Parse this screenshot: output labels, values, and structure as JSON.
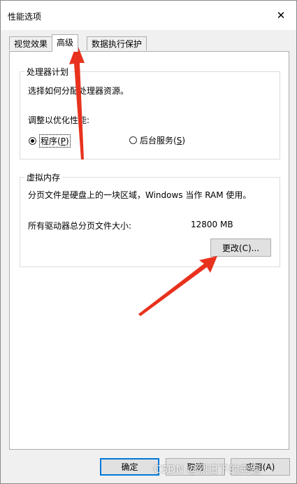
{
  "window": {
    "title": "性能选项",
    "close_glyph": "✕"
  },
  "tabs": [
    {
      "label": "视觉效果",
      "active": false
    },
    {
      "label": "高级",
      "active": true
    },
    {
      "label": "数据执行保护",
      "active": false
    }
  ],
  "processor": {
    "legend": "处理器计划",
    "description": "选择如何分配处理器资源。",
    "adjust_label": "调整以优化性能:",
    "options": [
      {
        "label": "程序(",
        "mnemonic": "P",
        "suffix": ")",
        "checked": true
      },
      {
        "label": "后台服务(",
        "mnemonic": "S",
        "suffix": ")",
        "checked": false
      }
    ]
  },
  "virtual_memory": {
    "legend": "虚拟内存",
    "description": "分页文件是硬盘上的一块区域，Windows 当作 RAM 使用。",
    "total_label": "所有驱动器总分页文件大小:",
    "total_value": "12800 MB",
    "change_button": "更改(C)..."
  },
  "buttons": {
    "ok": "确定",
    "cancel": "取消",
    "apply": "应用(A)"
  },
  "watermark": "CSDN @烈日下的奔跑",
  "colors": {
    "annotation_red": "#e8321e",
    "accent": "#0078d7"
  }
}
